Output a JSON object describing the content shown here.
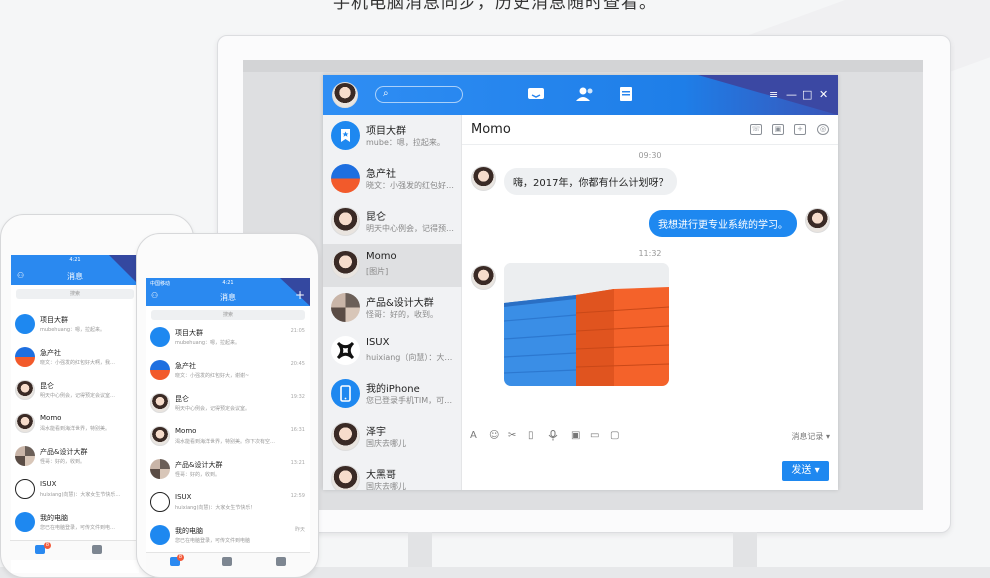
{
  "headline": "手机电脑消息同步，历史消息随时查看。",
  "desktop": {
    "search_icon": "search-icon",
    "tabs": [
      "message-icon",
      "contacts-icon",
      "files-icon"
    ],
    "window_controls": [
      "≡",
      "—",
      "□",
      "✕"
    ],
    "chats": [
      {
        "name": "项目大群",
        "msg": "mube：嗯，拉起来。",
        "avatar_color": "#1e88f0"
      },
      {
        "name": "急产社",
        "msg": "晓文：小强发的红包好…",
        "avatar_color": "#f25a2b"
      },
      {
        "name": "昆仑",
        "msg": "明天中心例会，记得预…",
        "avatar_color": "#d9c3b4"
      },
      {
        "name": "Momo",
        "msg": "[图片]",
        "avatar_color": "#c9b3a3"
      },
      {
        "name": "产品&设计大群",
        "msg": "怪哥：好的，收到。",
        "avatar_color": "#9a8a80"
      },
      {
        "name": "ISUX",
        "msg": "huixiang（向慧）：大…",
        "avatar_color": "#111111"
      },
      {
        "name": "我的iPhone",
        "msg": "您已登录手机TIM，可…",
        "avatar_color": "#1e88f0"
      },
      {
        "name": "泽宇",
        "msg": "国庆去哪儿",
        "avatar_color": "#b0a49a"
      },
      {
        "name": "大黑哥",
        "msg": "国庆去哪儿",
        "avatar_color": "#c8b5a5"
      }
    ],
    "chat_title": "Momo",
    "header_icons": [
      "phone-icon",
      "screen-icon",
      "add-icon",
      "settings-icon"
    ],
    "messages": [
      {
        "time": "09:30"
      },
      {
        "text": "嗨，2017年，你都有什么计划呀？",
        "dir": "in"
      },
      {
        "text": "我想进行更专业系统的学习。",
        "dir": "out"
      },
      {
        "time": "11:32"
      }
    ],
    "toolbar": [
      "A",
      "☺",
      "✂",
      "▯",
      "🎙",
      "▣",
      "▭",
      "▢"
    ],
    "history_label": "消息记录",
    "send_label": "发送"
  },
  "phone_left": {
    "status_time": "4:21",
    "title": "消息",
    "search": "搜索",
    "items": [
      {
        "name": "项目大群",
        "msg": "mubehuang：嗯，拉起来。"
      },
      {
        "name": "急产社",
        "msg": "晓文：小强发的红包好大啊，我…"
      },
      {
        "name": "昆仑",
        "msg": "明天中心例会，记得预定会议室…"
      },
      {
        "name": "Momo",
        "msg": "渴水能看到海洋世界，特别美。"
      },
      {
        "name": "产品&设计大群",
        "msg": "怪哥：好的，收到。"
      },
      {
        "name": "ISUX",
        "msg": "huixiang(向慧)：大家女生节快乐…"
      },
      {
        "name": "我的电脑",
        "msg": "您已在电脑登录，可传文件到电…"
      }
    ],
    "badge": "8"
  },
  "phone_right": {
    "carrier": "中国移动",
    "status_time": "4:21",
    "title": "消息",
    "search": "搜索",
    "items": [
      {
        "name": "项目大群",
        "msg": "mubehuang：嗯，拉起来。",
        "time": "21:05"
      },
      {
        "name": "急产社",
        "msg": "晓文：小强发的红包好大，谢谢~",
        "time": "20:45"
      },
      {
        "name": "昆仑",
        "msg": "明天中心例会，记得预定会议室。",
        "time": "19:32"
      },
      {
        "name": "Momo",
        "msg": "渴水能看到海洋世界，特别美。你下次有空…",
        "time": "16:31"
      },
      {
        "name": "产品&设计大群",
        "msg": "怪哥：好的，收到。",
        "time": "13:21"
      },
      {
        "name": "ISUX",
        "msg": "huixiang(向慧)：大家女生节快乐！",
        "time": "12:59"
      },
      {
        "name": "我的电脑",
        "msg": "您已在电脑登录，可传文件到电脑",
        "time": "昨天"
      }
    ],
    "badge": "8"
  }
}
